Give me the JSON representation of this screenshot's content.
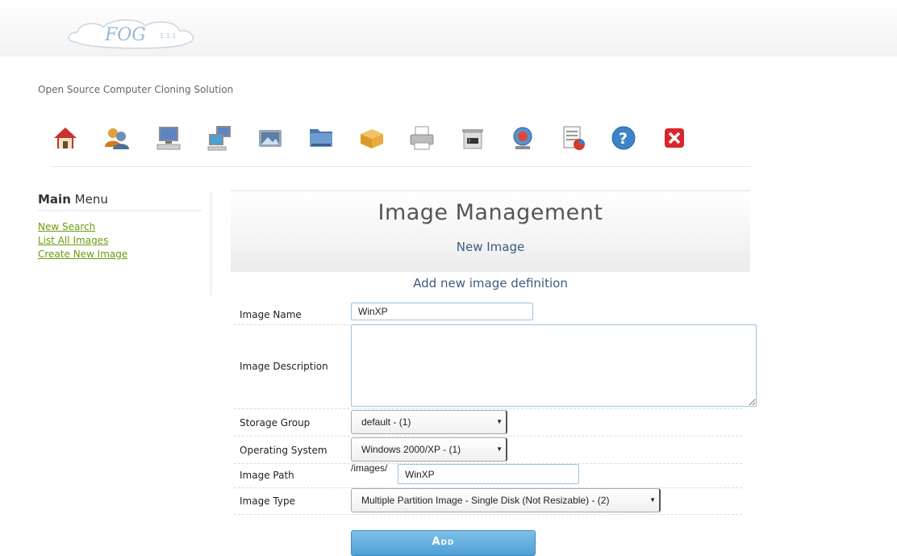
{
  "header": {
    "logo_text": "FOG",
    "version": "1.1.1",
    "tagline": "Open Source Computer Cloning Solution"
  },
  "toolbar": {
    "icons": [
      "home-icon",
      "users-icon",
      "host-icon",
      "groups-icon",
      "images-icon",
      "storage-icon",
      "snapins-icon",
      "printers-icon",
      "service-icon",
      "tasks-icon",
      "reports-icon",
      "help-icon",
      "logout-icon"
    ]
  },
  "menu": {
    "title_bold": "Main",
    "title_rest": " Menu",
    "items": [
      "New Search",
      "List All Images",
      "Create New Image"
    ]
  },
  "banner": {
    "title": "Image Management",
    "subtitle": "New Image"
  },
  "form": {
    "heading": "Add new image definition",
    "image_name_label": "Image Name",
    "image_name_value": "WinXP",
    "image_description_label": "Image Description",
    "image_description_value": "",
    "storage_group_label": "Storage Group",
    "storage_group_value": "default - (1)",
    "os_label": "Operating System",
    "os_value": "Windows 2000/XP - (1)",
    "image_path_label": "Image Path",
    "image_path_prefix": "/images/",
    "image_path_value": "WinXP",
    "image_type_label": "Image Type",
    "image_type_value": "Multiple Partition Image - Single Disk (Not Resizable) - (2)",
    "add_button": "Add"
  },
  "colors": {
    "link": "#6b9a0e",
    "heading_blue": "#3d5a80",
    "button": "#4e9fd6"
  }
}
